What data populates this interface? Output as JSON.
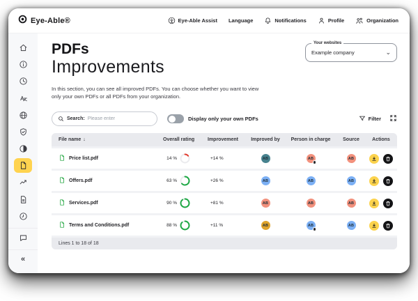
{
  "navbar": {
    "brand": "Eye-Able®",
    "items": [
      {
        "label": "Eye-Able Assist",
        "icon": "assist-accessibility-circle-icon"
      },
      {
        "label": "Language",
        "icon": "none"
      },
      {
        "label": "Notifications",
        "icon": "bell-icon"
      },
      {
        "label": "Profile",
        "icon": "person-icon"
      },
      {
        "label": "Organization",
        "icon": "people-icon"
      }
    ]
  },
  "sidebar": {
    "items": [
      {
        "icon": "home-icon",
        "active": false
      },
      {
        "icon": "info-circle-icon",
        "active": false
      },
      {
        "icon": "history-icon",
        "active": false
      },
      {
        "icon": "translate-icon",
        "active": false
      },
      {
        "icon": "globe-icon",
        "active": false
      },
      {
        "icon": "shield-check-icon",
        "active": false
      },
      {
        "icon": "contrast-icon",
        "active": false
      },
      {
        "icon": "pdf-file-icon",
        "active": true
      },
      {
        "icon": "trending-up-icon",
        "active": false
      },
      {
        "icon": "report-icon",
        "active": false
      },
      {
        "icon": "time-icon",
        "active": false
      },
      {
        "icon": "chat-icon",
        "active": false
      }
    ],
    "collapse_glyph": "«"
  },
  "icons": {
    "chevron_down": "⌄",
    "sort_desc": "↓"
  },
  "page": {
    "title_line1": "PDFs",
    "title_line2": "Improvements",
    "description": "In this section, you can see all improved PDFs. You can choose whether you want to view only your own PDFs or all PDFs from your organization.",
    "website_select": {
      "label": "Your websites",
      "value": "Example company"
    },
    "search": {
      "label": "Search:",
      "placeholder": "Please enter"
    },
    "toggle_label": "Display only your own PDFs",
    "filter_label": "Filter"
  },
  "colors": {
    "accent_yellow": "#ffd34f",
    "green": "#1da844",
    "red": "#e23b2e",
    "avatar_teal": "#47828e",
    "avatar_salmon": "#f2917d",
    "avatar_blue": "#7cb0f5",
    "avatar_gold": "#dfa32b"
  },
  "table": {
    "columns": [
      "File name",
      "Overall rating",
      "Improvement",
      "Improved by",
      "Person in charge",
      "Source",
      "Actions"
    ],
    "rows": [
      {
        "file": "Price list.pdf",
        "rating_label": "14 %",
        "rating_pct": 14,
        "rating_color": "#e23b2e",
        "improvement": "+14 %",
        "avatars": {
          "improved_by": {
            "text": "AB",
            "bg": "#47828e",
            "badge": false
          },
          "person": {
            "text": "AB",
            "bg": "#f2917d",
            "badge": true
          },
          "source": {
            "text": "AB",
            "bg": "#f2917d",
            "badge": false
          }
        }
      },
      {
        "file": "Offers.pdf",
        "rating_label": "63 %",
        "rating_pct": 63,
        "rating_color": "#1da844",
        "improvement": "+26 %",
        "avatars": {
          "improved_by": {
            "text": "AB",
            "bg": "#7cb0f5",
            "badge": false
          },
          "person": {
            "text": "AB",
            "bg": "#7cb0f5",
            "badge": false
          },
          "source": {
            "text": "AB",
            "bg": "#7cb0f5",
            "badge": false
          }
        }
      },
      {
        "file": "Services.pdf",
        "rating_label": "90 %",
        "rating_pct": 90,
        "rating_color": "#1da844",
        "improvement": "+81 %",
        "avatars": {
          "improved_by": {
            "text": "AB",
            "bg": "#f2917d",
            "badge": false
          },
          "person": {
            "text": "AB",
            "bg": "#f2917d",
            "badge": false
          },
          "source": {
            "text": "AB",
            "bg": "#f2917d",
            "badge": false
          }
        }
      },
      {
        "file": "Terms and Conditions.pdf",
        "rating_label": "88 %",
        "rating_pct": 88,
        "rating_color": "#1da844",
        "improvement": "+11 %",
        "avatars": {
          "improved_by": {
            "text": "AB",
            "bg": "#dfa32b",
            "badge": false
          },
          "person": {
            "text": "AB",
            "bg": "#7cb0f5",
            "badge": true
          },
          "source": {
            "text": "AB",
            "bg": "#7cb0f5",
            "badge": false
          }
        }
      }
    ],
    "footer": "Lines 1 to 18 of 18"
  }
}
